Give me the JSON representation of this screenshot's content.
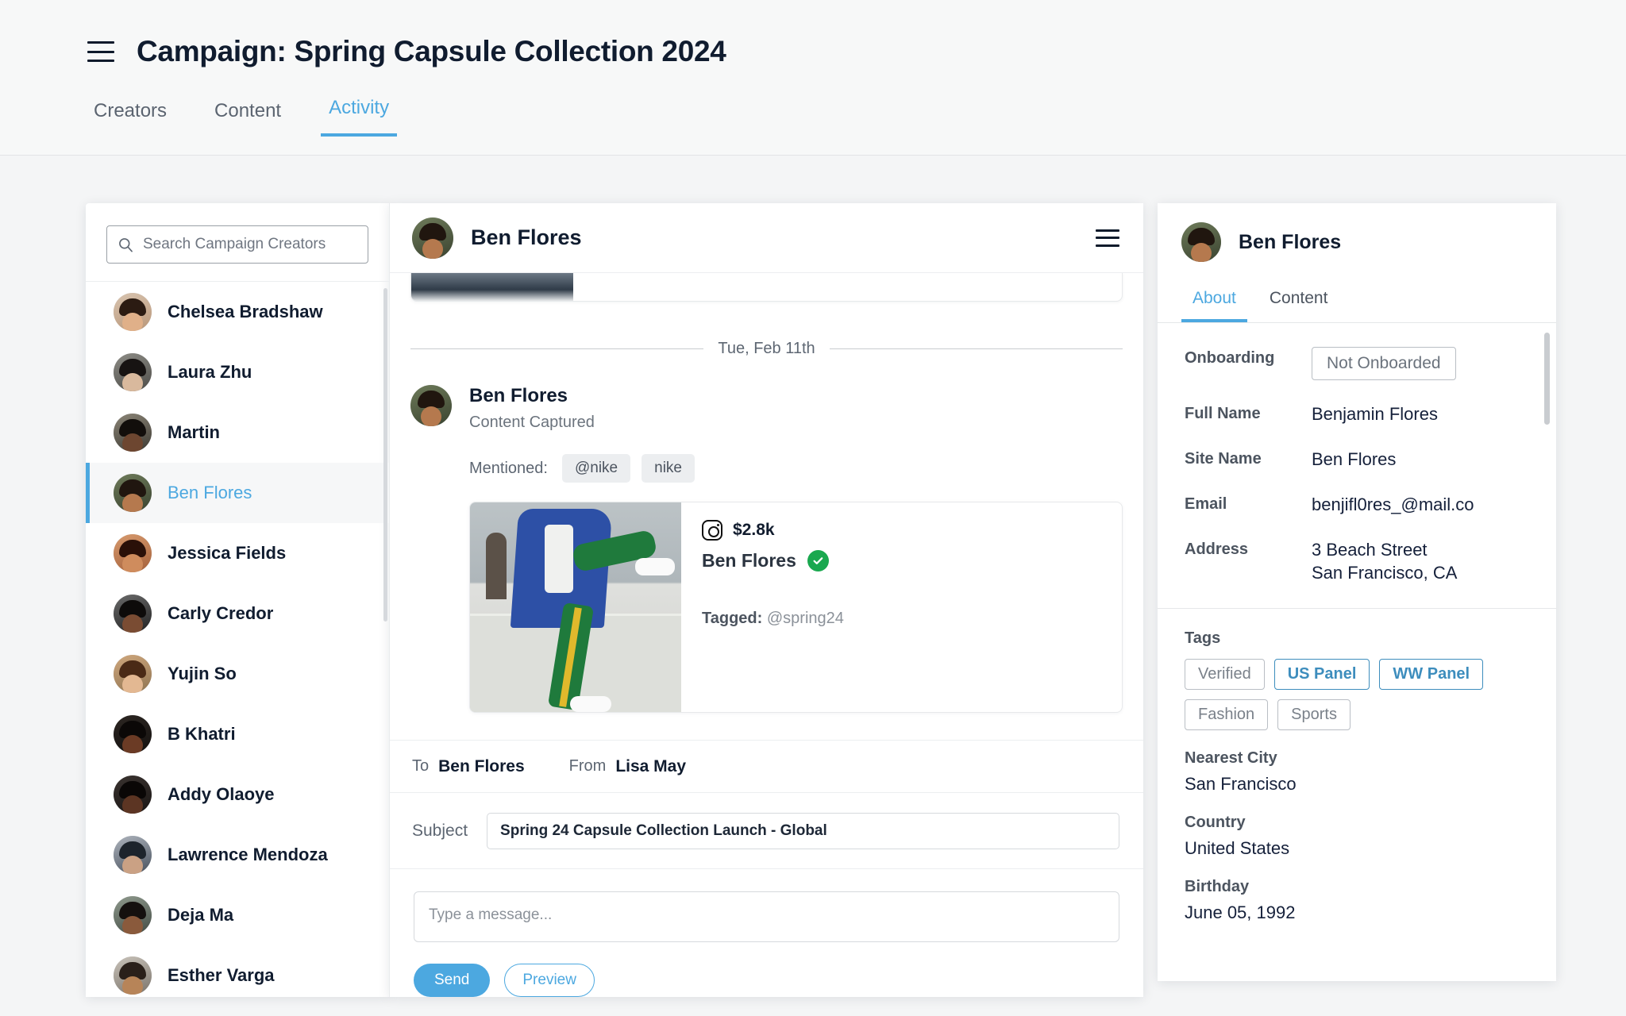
{
  "header": {
    "menu_icon": "hamburger-icon",
    "title": "Campaign: Spring Capsule Collection 2024",
    "tabs": [
      {
        "label": "Creators",
        "active": false
      },
      {
        "label": "Content",
        "active": false
      },
      {
        "label": "Activity",
        "active": true
      }
    ]
  },
  "accent_color": "#4ca8e0",
  "creators_panel": {
    "search": {
      "icon": "search-icon",
      "placeholder": "Search Campaign Creators",
      "value": ""
    },
    "items": [
      {
        "name": "Chelsea Bradshaw",
        "selected": false
      },
      {
        "name": "Laura Zhu",
        "selected": false
      },
      {
        "name": "Martin",
        "selected": false
      },
      {
        "name": "Ben Flores",
        "selected": true
      },
      {
        "name": "Jessica Fields",
        "selected": false
      },
      {
        "name": "Carly Credor",
        "selected": false
      },
      {
        "name": "Yujin So",
        "selected": false
      },
      {
        "name": "B Khatri",
        "selected": false
      },
      {
        "name": "Addy Olaoye",
        "selected": false
      },
      {
        "name": "Lawrence Mendoza",
        "selected": false
      },
      {
        "name": "Deja Ma",
        "selected": false
      },
      {
        "name": "Esther Varga",
        "selected": false
      }
    ]
  },
  "conversation": {
    "header": {
      "name": "Ben Flores",
      "menu_icon": "hamburger-icon"
    },
    "date_divider": "Tue, Feb 11th",
    "message": {
      "author": "Ben Flores",
      "subtitle": "Content Captured",
      "mentioned_label": "Mentioned:",
      "mentions": [
        "@nike",
        "nike"
      ],
      "content_card": {
        "platform_icon": "instagram-icon",
        "value": "$2.8k",
        "creator_name": "Ben Flores",
        "verified_icon": "verified-check-icon",
        "tagged_label": "Tagged:",
        "tagged_value": "@spring24"
      }
    },
    "to_label": "To",
    "to_value": "Ben Flores",
    "from_label": "From",
    "from_value": "Lisa May",
    "subject_label": "Subject",
    "subject_value": "Spring 24 Capsule Collection Launch - Global",
    "composer": {
      "placeholder": "Type a message...",
      "value": "",
      "send_label": "Send",
      "preview_label": "Preview"
    }
  },
  "profile": {
    "name": "Ben Flores",
    "tabs": [
      {
        "label": "About",
        "active": true
      },
      {
        "label": "Content",
        "active": false
      }
    ],
    "about": [
      {
        "label": "Onboarding",
        "value": "Not Onboarded",
        "pill": true
      },
      {
        "label": "Full Name",
        "value": "Benjamin Flores"
      },
      {
        "label": "Site Name",
        "value": "Ben Flores"
      },
      {
        "label": "Email",
        "value": "benjifl0res_@mail.co"
      },
      {
        "label": "Address",
        "value": "3 Beach Street\nSan Francisco, CA"
      }
    ],
    "tags_label": "Tags",
    "tags": [
      {
        "label": "Verified",
        "accent": false
      },
      {
        "label": "US Panel",
        "accent": true
      },
      {
        "label": "WW Panel",
        "accent": true
      },
      {
        "label": "Fashion",
        "accent": false
      },
      {
        "label": "Sports",
        "accent": false
      }
    ],
    "details": [
      {
        "label": "Nearest City",
        "value": "San Francisco"
      },
      {
        "label": "Country",
        "value": "United States"
      },
      {
        "label": "Birthday",
        "value": "June 05, 1992"
      }
    ]
  }
}
